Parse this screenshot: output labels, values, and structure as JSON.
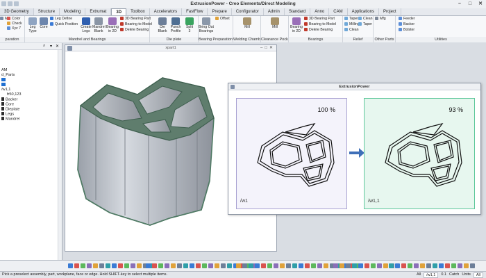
{
  "window": {
    "title": "ExtrusionPower - Creo Elements/Direct Modeling"
  },
  "tabs": [
    {
      "label": "3D Geometry"
    },
    {
      "label": "Structure"
    },
    {
      "label": "Modeling"
    },
    {
      "label": "Extrumat"
    },
    {
      "label": "3D"
    },
    {
      "label": "Toolbox"
    },
    {
      "label": "Accelerators"
    },
    {
      "label": "FastFlow"
    },
    {
      "label": "Prepare"
    },
    {
      "label": "Configurator"
    },
    {
      "label": "Admin"
    },
    {
      "label": "Standard"
    },
    {
      "label": "Anno"
    },
    {
      "label": "CAM"
    },
    {
      "label": "Applications"
    },
    {
      "label": "Project"
    }
  ],
  "active_tab_index": 4,
  "ribbon": {
    "groups": [
      {
        "label": "paration"
      },
      {
        "label": "Mandrel and Bearings"
      },
      {
        "label": "Die plate"
      },
      {
        "label": "Bearing Preparation"
      },
      {
        "label": "Welding Chamber"
      },
      {
        "label": "Clearance Pocket"
      },
      {
        "label": "Bearings"
      },
      {
        "label": "Relief"
      },
      {
        "label": "Other Parts"
      },
      {
        "label": "Utilities"
      }
    ],
    "buttons": {
      "mil": "Mil",
      "color": "Color",
      "check": "Check",
      "xyz": "Xyz 7",
      "leg_type": "Leg Type",
      "core": "Core",
      "leg_define": "Leg Define",
      "quick_position": "Quick Position",
      "create_legs": "Create Legs",
      "mandrel_blank": "Mandrel Blank",
      "bearing_in_2d": "Bearing in 2D",
      "bearing_part_3d": "3D Bearing Part",
      "bearing_to_model": "Bearing to Model",
      "delete_bearing": "Delete Bearing",
      "die_blank": "Die Blank",
      "punch_profile": "Punch Profile",
      "split_3": "Split 3",
      "bring_out_bearings": "Bring Out Bearings",
      "offset": "Offset",
      "mill_1": "Mill",
      "mill_2": "Mill",
      "bearing_in_2d_b": "Bearing in 2D",
      "bearing_part_3d_b": "3D Bearing Part",
      "bearing_to_model_b": "Bearing to Model",
      "delete_bearing_b": "Delete Bearing",
      "taper": "Taper",
      "milling": "Milling",
      "clean": "Clean",
      "clean_2": "Clean",
      "taper_2": "Taper",
      "mfg": "Mfg",
      "feeder": "Feeder",
      "backer": "Backer",
      "bolster": "Bolster"
    }
  },
  "tree": {
    "items": [
      {
        "label": "AM"
      },
      {
        "label": "d_Parts"
      },
      {
        "label": ""
      },
      {
        "label": ""
      },
      {
        "label": "/w1,1"
      },
      {
        "label": "fr50,123"
      },
      {
        "label": "Backer"
      },
      {
        "label": "Core"
      },
      {
        "label": "Dieplate"
      },
      {
        "label": "Legs"
      },
      {
        "label": "Mandrel"
      }
    ]
  },
  "viewport": {
    "title": "xpart1"
  },
  "comparison": {
    "title": "ExtrusionPower",
    "before": {
      "percent": "100 %",
      "name": "/w1"
    },
    "after": {
      "percent": "93 %",
      "name": "/w1,1"
    }
  },
  "statusbar": {
    "message": "Pick a preselect assembly, part, workplane, face or edge. Hold SHIFT-key to select multiple items.",
    "mode": "All",
    "path": "/w1,1",
    "ratio": "0.1",
    "catch_label": "Catch",
    "units_label": "Units",
    "units_value": "All"
  },
  "colors": {
    "accent": "#1f6fd1",
    "before_panel": "#a9a2d2",
    "after_panel": "#5cc79a",
    "arrow": "#3f6fb8",
    "profile_metal": "#b9bec6",
    "profile_edge": "#4f7a64"
  }
}
